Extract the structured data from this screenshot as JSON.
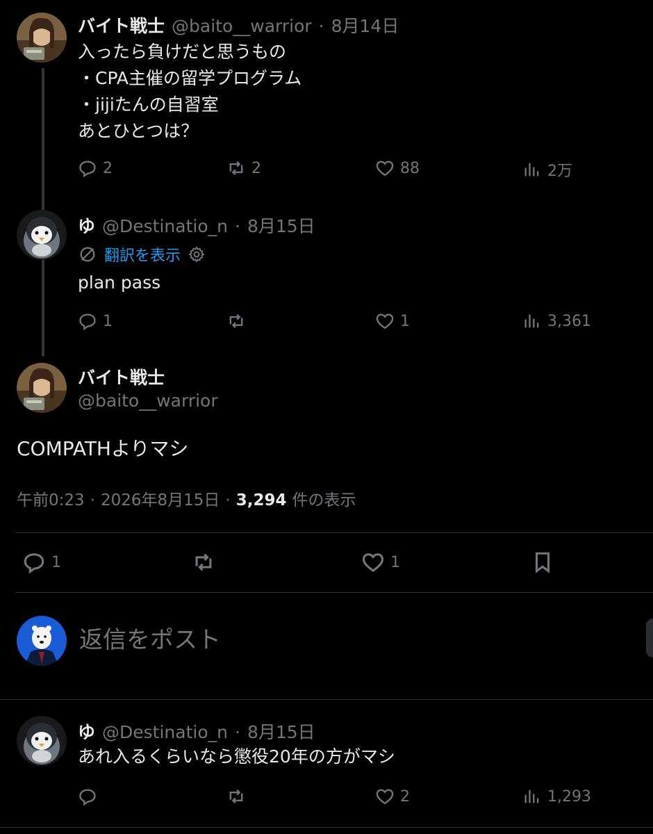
{
  "thread": [
    {
      "name": "バイト戦士",
      "handle": "@baito__warrior",
      "date": "8月14日",
      "text": "入ったら負けだと思うもの\n・CPA主催の留学プログラム\n・jijiたんの自習室\nあとひとつは？",
      "replies": "2",
      "reposts": "2",
      "likes": "88",
      "views": "2万"
    },
    {
      "name": "ゆ",
      "handle": "@Destinatio_n",
      "date": "8月15日",
      "translate": "翻訳を表示",
      "text": "plan pass",
      "replies": "1",
      "reposts": "",
      "likes": "1",
      "views": "3,361"
    }
  ],
  "main": {
    "name": "バイト戦士",
    "handle": "@baito__warrior",
    "text": "COMPATHよりマシ",
    "time": "午前0:23",
    "date": "2026年8月15日",
    "view_count": "3,294",
    "view_label": "件の表示",
    "replies": "1",
    "reposts": "",
    "likes": "1"
  },
  "compose": {
    "placeholder": "返信をポスト"
  },
  "reply": {
    "name": "ゆ",
    "handle": "@Destinatio_n",
    "date": "8月15日",
    "text": "あれ入るくらいなら懲役20年の方がマシ",
    "replies": "",
    "reposts": "",
    "likes": "2",
    "views": "1,293"
  },
  "sep": "·",
  "colors": {
    "bg": "#000000",
    "text": "#e7e9ea",
    "muted": "#71767b",
    "link": "#1d9bf0",
    "divider": "#2f3336"
  }
}
